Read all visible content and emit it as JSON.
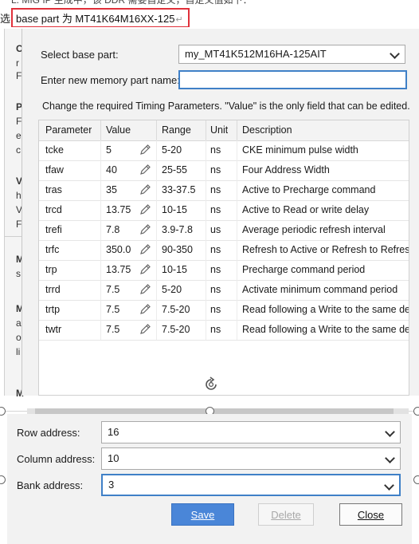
{
  "document": {
    "top_fragment": "L. MIG IP 生成中，该 DDR 需要自定义，自定义值如下：",
    "line_prefix": "选",
    "highlight_text": "base part 为   MT41K64M16XX-125",
    "highlight_mark": "↵",
    "left_fragments": [
      "C",
      "r",
      "F",
      "P",
      "F",
      "e",
      "c",
      "V",
      "h",
      "V",
      "F",
      "M",
      "s",
      "M",
      "a",
      "o",
      "li",
      "M"
    ]
  },
  "dialog": {
    "base_part_label": "Select base part:",
    "base_part_value": "my_MT41K512M16HA-125AIT",
    "new_part_label": "Enter new memory part name:",
    "new_part_value": "",
    "hint": "Change the required Timing Parameters. \"Value\" is the only field that can be edited.",
    "table": {
      "headers": [
        "Parameter",
        "Value",
        "Range",
        "Unit",
        "Description"
      ],
      "rows": [
        {
          "param": "tcke",
          "value": "5",
          "range": "5-20",
          "unit": "ns",
          "desc": "CKE minimum pulse width"
        },
        {
          "param": "tfaw",
          "value": "40",
          "range": "25-55",
          "unit": "ns",
          "desc": "Four Address Width"
        },
        {
          "param": "tras",
          "value": "35",
          "range": "33-37.5",
          "unit": "ns",
          "desc": "Active to Precharge command"
        },
        {
          "param": "trcd",
          "value": "13.75",
          "range": "10-15",
          "unit": "ns",
          "desc": "Active to Read or write delay"
        },
        {
          "param": "trefi",
          "value": "7.8",
          "range": "3.9-7.8",
          "unit": "us",
          "desc": "Average periodic refresh interval"
        },
        {
          "param": "trfc",
          "value": "350.0",
          "range": "90-350",
          "unit": "ns",
          "desc": "Refresh to Active or Refresh to Refresh"
        },
        {
          "param": "trp",
          "value": "13.75",
          "range": "10-15",
          "unit": "ns",
          "desc": "Precharge command period"
        },
        {
          "param": "trrd",
          "value": "7.5",
          "range": "5-20",
          "unit": "ns",
          "desc": "Activate minimum command period"
        },
        {
          "param": "trtp",
          "value": "7.5",
          "range": "7.5-20",
          "unit": "ns",
          "desc": "Read following a Write to the same dev"
        },
        {
          "param": "twtr",
          "value": "7.5",
          "range": "7.5-20",
          "unit": "ns",
          "desc": "Read following a Write to the same dev"
        }
      ]
    },
    "row_address_label": "Row address:",
    "row_address_value": "16",
    "column_address_label": "Column address:",
    "column_address_value": "10",
    "bank_address_label": "Bank address:",
    "bank_address_value": "3",
    "buttons": {
      "save": "Save",
      "delete": "Delete",
      "close": "Close"
    }
  },
  "colors": {
    "accent": "#4a86d8",
    "focus_border": "#3f80c7",
    "highlight_box": "#e0303a",
    "dialog_bg": "#f2f2f2"
  },
  "icons": [
    "pencil-icon",
    "chevron-down-icon",
    "rotate-handle-icon"
  ]
}
